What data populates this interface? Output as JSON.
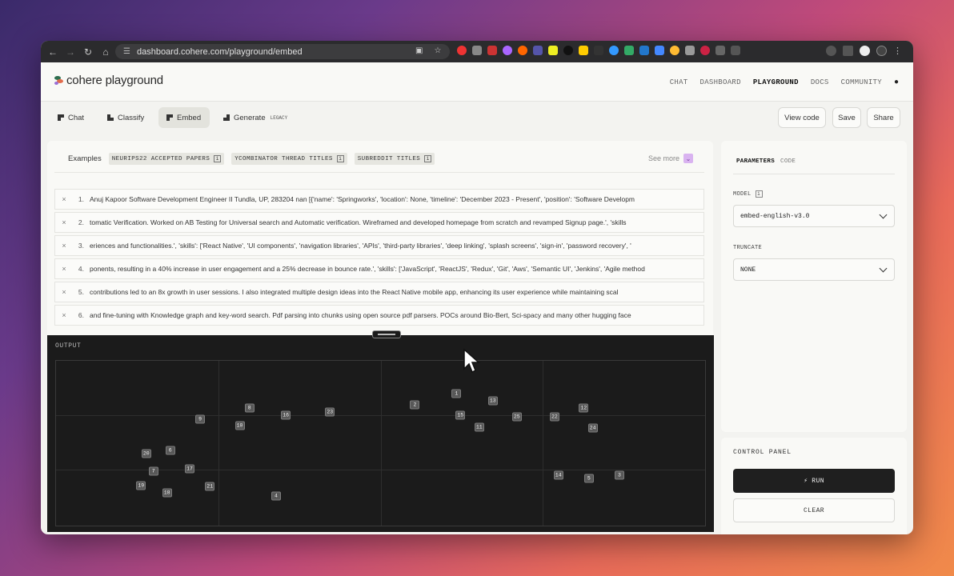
{
  "browser": {
    "url": "dashboard.cohere.com/playground/embed"
  },
  "header": {
    "logo_text": "cohere playground",
    "nav": [
      {
        "label": "CHAT",
        "active": false
      },
      {
        "label": "DASHBOARD",
        "active": false
      },
      {
        "label": "PLAYGROUND",
        "active": true
      },
      {
        "label": "DOCS",
        "active": false
      },
      {
        "label": "COMMUNITY",
        "active": false
      }
    ]
  },
  "tabs": {
    "chat": "Chat",
    "classify": "Classify",
    "embed": "Embed",
    "generate": "Generate",
    "generate_badge": "LEGACY",
    "active": "Embed"
  },
  "actions": {
    "view_code": "View code",
    "save": "Save",
    "share": "Share"
  },
  "examples": {
    "label": "Examples",
    "chips": [
      "NEURIPS22 ACCEPTED PAPERS",
      "YCOMBINATOR THREAD TITLES",
      "SUBREDDIT TITLES"
    ],
    "see_more": "See more"
  },
  "inputs": [
    {
      "num": "1.",
      "text": "Anuj Kapoor Software Development Engineer II Tundla, UP, 283204 nan [{'name': 'Springworks', 'location': None, 'timeline': 'December 2023 - Present', 'position': 'Software Developm"
    },
    {
      "num": "2.",
      "text": "tomatic Verification. Worked on AB Testing for Universal search and Automatic verification. Wireframed and developed homepage from scratch and revamped Signup page.', 'skills"
    },
    {
      "num": "3.",
      "text": "eriences and functionalities.', 'skills': ['React Native', 'UI components', 'navigation libraries', 'APIs', 'third-party libraries', 'deep linking', 'splash screens', 'sign-in', 'password recovery', '"
    },
    {
      "num": "4.",
      "text": "ponents, resulting in a 40% increase in user engagement and a 25% decrease in bounce rate.', 'skills': ['JavaScript', 'ReactJS', 'Redux', 'Git', 'Aws', 'Semantic UI', 'Jenkins', 'Agile method"
    },
    {
      "num": "5.",
      "text": "contributions led to an 8x growth in user sessions. I also integrated multiple design ideas into the React Native mobile app, enhancing its user experience while maintaining scal"
    },
    {
      "num": "6.",
      "text": "and fine-tuning with Knowledge graph and key-word search. Pdf parsing into chunks using open source pdf parsers. POCs around Bio-Bert, Sci-spacy and many other hugging face"
    }
  ],
  "output": {
    "label": "OUTPUT"
  },
  "chart_data": {
    "type": "scatter",
    "points": [
      {
        "label": "1",
        "x": 0.617,
        "y": 0.803
      },
      {
        "label": "2",
        "x": 0.553,
        "y": 0.733
      },
      {
        "label": "3",
        "x": 0.868,
        "y": 0.308
      },
      {
        "label": "4",
        "x": 0.339,
        "y": 0.178
      },
      {
        "label": "5",
        "x": 0.821,
        "y": 0.284
      },
      {
        "label": "6",
        "x": 0.176,
        "y": 0.457
      },
      {
        "label": "7",
        "x": 0.15,
        "y": 0.332
      },
      {
        "label": "8",
        "x": 0.298,
        "y": 0.716
      },
      {
        "label": "9",
        "x": 0.222,
        "y": 0.644
      },
      {
        "label": "10",
        "x": 0.283,
        "y": 0.606
      },
      {
        "label": "11",
        "x": 0.652,
        "y": 0.596
      },
      {
        "label": "12",
        "x": 0.813,
        "y": 0.716
      },
      {
        "label": "13",
        "x": 0.673,
        "y": 0.755
      },
      {
        "label": "14",
        "x": 0.774,
        "y": 0.308
      },
      {
        "label": "15",
        "x": 0.623,
        "y": 0.668
      },
      {
        "label": "16",
        "x": 0.354,
        "y": 0.668
      },
      {
        "label": "17",
        "x": 0.206,
        "y": 0.344
      },
      {
        "label": "18",
        "x": 0.171,
        "y": 0.197
      },
      {
        "label": "19",
        "x": 0.131,
        "y": 0.245
      },
      {
        "label": "20",
        "x": 0.139,
        "y": 0.437
      },
      {
        "label": "21",
        "x": 0.237,
        "y": 0.236
      },
      {
        "label": "22",
        "x": 0.768,
        "y": 0.659
      },
      {
        "label": "23",
        "x": 0.422,
        "y": 0.688
      },
      {
        "label": "24",
        "x": 0.827,
        "y": 0.591
      },
      {
        "label": "25",
        "x": 0.71,
        "y": 0.659
      }
    ]
  },
  "parameters": {
    "tab_parameters": "PARAMETERS",
    "tab_code": "CODE",
    "model_label": "MODEL",
    "model_value": "embed-english-v3.0",
    "truncate_label": "TRUNCATE",
    "truncate_value": "NONE"
  },
  "control_panel": {
    "title": "CONTROL PANEL",
    "run_label": "RUN",
    "clear_label": "CLEAR"
  }
}
